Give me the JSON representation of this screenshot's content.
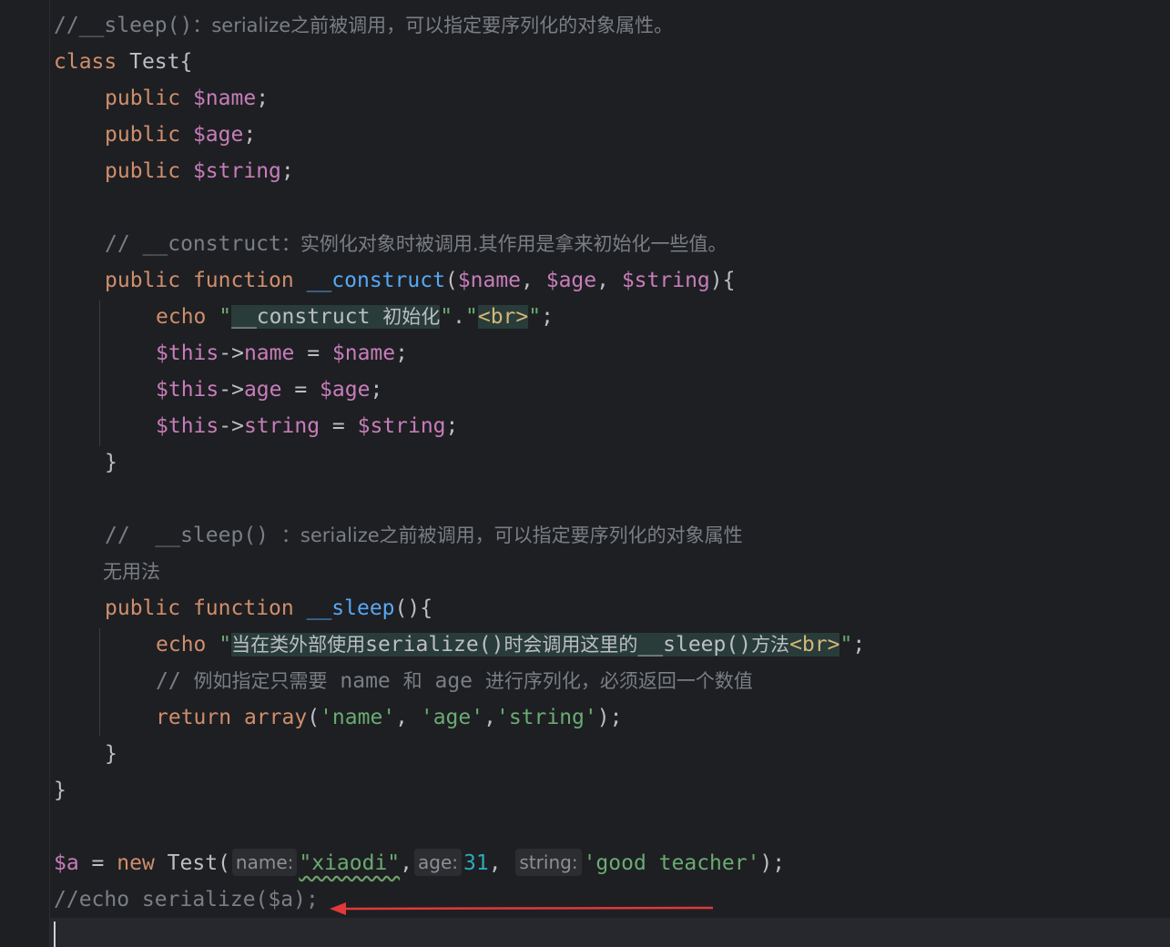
{
  "editor": {
    "lines": {
      "l1_comment": "//__sleep()",
      "l1_comment_cn": "：serialize之前被调用，可以指定要序列化的对象属性。",
      "l2_class": "class",
      "l2_name": "Test{",
      "l3_public": "public",
      "l3_var": "$name",
      "l4_public": "public",
      "l4_var": "$age",
      "l5_public": "public",
      "l5_var": "$string",
      "l7_comment": "// __construct",
      "l7_comment_cn": "：实例化对象时被调用.其作用是拿来初始化一些值。",
      "l8_public": "public",
      "l8_function": "function",
      "l8_fn": "__construct",
      "l8_params_a": "$name",
      "l8_params_b": "$age",
      "l8_params_c": "$string",
      "l9_echo": "echo",
      "l9_str1": "__construct ",
      "l9_str1_cn": "初始化",
      "l9_tag": "<br>",
      "l10_this": "$this",
      "l10_prop": "name",
      "l10_var": "$name",
      "l11_this": "$this",
      "l11_prop": "age",
      "l11_var": "$age",
      "l12_this": "$this",
      "l12_prop": "string",
      "l12_var": "$string",
      "l13_close": "}",
      "l15_comment": "//  __sleep() ",
      "l15_comment_cn": "：serialize之前被调用，可以指定要序列化的对象属性",
      "l16_comment_cn": "无用法",
      "l17_public": "public",
      "l17_function": "function",
      "l17_fn": "__sleep",
      "l18_echo": "echo",
      "l18_str_cn1": "当在类外部使用",
      "l18_str_mid": "serialize()",
      "l18_str_cn2": "时会调用这里的",
      "l18_str_mid2": "__sleep()",
      "l18_str_cn3": "方法",
      "l18_tag": "<br>",
      "l19_comment": "// ",
      "l19_comment_cn1": "例如指定只需要",
      "l19_comment_name": " name ",
      "l19_comment_cn2": "和",
      "l19_comment_age": " age ",
      "l19_comment_cn3": "进行序列化，必须返回一个数值",
      "l20_return": "return",
      "l20_array": "array",
      "l20_s1": "'name'",
      "l20_s2": "'age'",
      "l20_s3": "'string'",
      "l21_close": "}",
      "l22_close": "}",
      "l24_var": "$a",
      "l24_new": "new",
      "l24_class": "Test(",
      "l24_hint_name": "name:",
      "l24_arg1": "\"xiaodi\"",
      "l24_hint_age": "age:",
      "l24_arg2": "31",
      "l24_hint_string": "string:",
      "l24_arg3": "'good teacher'",
      "l25_comment": "//echo serialize($a);"
    }
  },
  "colors": {
    "background": "#1e1f22",
    "keyword": "#cf8e6d",
    "variable": "#c77dbb",
    "function": "#56a8f5",
    "string": "#6aab73",
    "number": "#2aacb8",
    "comment": "#7a7e85",
    "annotation_arrow": "#e0393a"
  }
}
